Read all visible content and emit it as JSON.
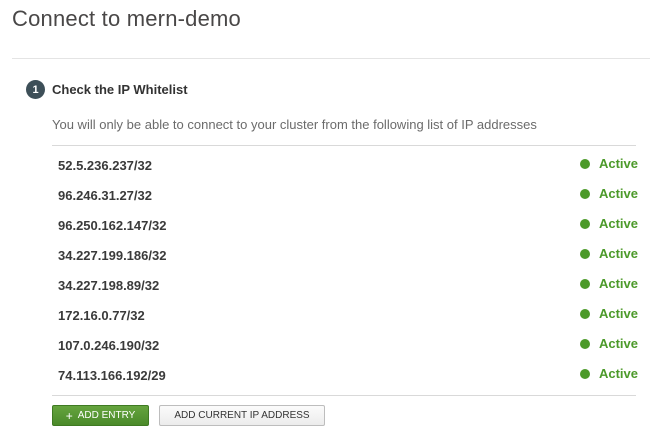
{
  "dialog": {
    "title": "Connect to mern-demo"
  },
  "step": {
    "number": "1",
    "title": "Check the IP Whitelist",
    "description": "You will only be able to connect to your cluster from the following list of IP addresses"
  },
  "ip_list": [
    {
      "address": "52.5.236.237/32",
      "status": "Active"
    },
    {
      "address": "96.246.31.27/32",
      "status": "Active"
    },
    {
      "address": "96.250.162.147/32",
      "status": "Active"
    },
    {
      "address": "34.227.199.186/32",
      "status": "Active"
    },
    {
      "address": "34.227.198.89/32",
      "status": "Active"
    },
    {
      "address": "172.16.0.77/32",
      "status": "Active"
    },
    {
      "address": "107.0.246.190/32",
      "status": "Active"
    },
    {
      "address": "74.113.166.192/29",
      "status": "Active"
    }
  ],
  "buttons": {
    "add_entry_icon": "+",
    "add_entry": "Add Entry",
    "add_current_ip": "Add Current IP Address"
  },
  "colors": {
    "active_status": "#4c9a2a",
    "primary_button": "#58973a",
    "step_badge": "#3d4f58"
  },
  "icons": {
    "status": "green-dot-icon",
    "add": "plus-icon"
  }
}
